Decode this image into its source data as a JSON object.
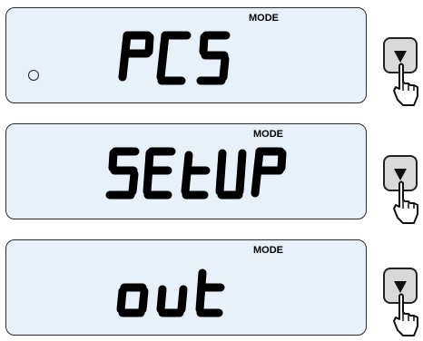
{
  "displays": [
    {
      "mode_label": "MODE",
      "text": "PCS",
      "stable_indicator": true
    },
    {
      "mode_label": "MODE",
      "text": "SEtUP",
      "stable_indicator": false
    },
    {
      "mode_label": "MODE",
      "text": "out",
      "stable_indicator": false
    }
  ],
  "buttons": [
    {
      "icon": "down-arrow-press-icon"
    },
    {
      "icon": "down-arrow-press-icon"
    },
    {
      "icon": "down-arrow-press-icon"
    }
  ],
  "colors": {
    "lcd_background": "#e8f1fa",
    "button_background": "#d9d9d9",
    "segment": "#000000"
  }
}
